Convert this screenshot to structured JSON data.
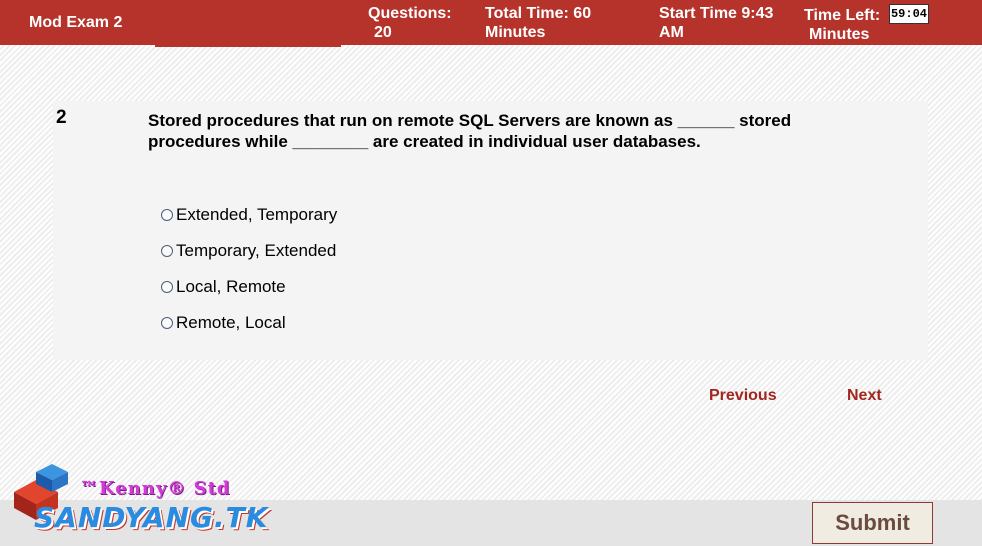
{
  "header": {
    "exam_title": "Mod Exam 2",
    "questions_label": "Questions:",
    "questions_value": "20",
    "total_time_label": "Total Time:  60",
    "total_time_unit": "Minutes",
    "start_time_label": "Start Time  9:43",
    "start_time_ampm": "AM",
    "time_left_label": "Time Left:",
    "time_left_unit": "Minutes",
    "timer": "59:04"
  },
  "question": {
    "number": "2",
    "text": "Stored procedures that run on remote SQL Servers are known as ______ stored procedures while ________ are created in individual user databases.",
    "options": [
      "Extended, Temporary",
      "Temporary, Extended",
      "Local, Remote",
      "Remote, Local"
    ]
  },
  "nav": {
    "previous": "Previous",
    "next": "Next",
    "submit": "Submit"
  },
  "logo": {
    "tagline": "™Kenny® Std",
    "brand": "SANDYANG.TK"
  },
  "colors": {
    "header_bg": "#b5332b",
    "nav_link": "#a1261f",
    "panel_bg": "#f4f4f4"
  }
}
